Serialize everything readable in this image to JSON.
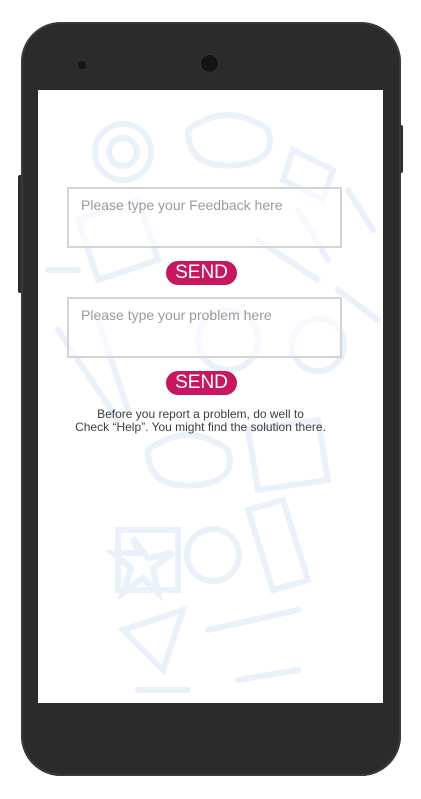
{
  "feedback": {
    "placeholder": "Please type your Feedback here",
    "send_label": "SEND"
  },
  "problem": {
    "placeholder": "Please type your problem here",
    "send_label": "SEND"
  },
  "help_note": {
    "line1": "Before you report a problem, do well to",
    "line2": "Check “Help”. You might find the solution there."
  },
  "colors": {
    "accent": "#c6175f",
    "phone_body": "#2b2b2b",
    "input_border": "#d4d4d4",
    "background_art": "#eef3fb"
  }
}
